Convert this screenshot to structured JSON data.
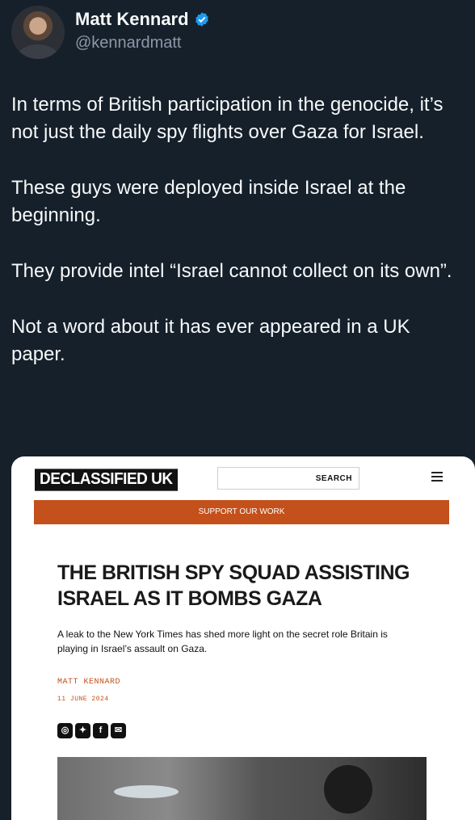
{
  "tweet": {
    "author_name": "Matt Kennard",
    "handle": "@kennardmatt",
    "verified": true,
    "paragraphs": [
      "In terms of British participation in the genocide, it’s not just the daily spy flights over Gaza for Israel.",
      "These guys were deployed inside Israel at the beginning.",
      "They provide intel “Israel cannot collect on its own”.",
      "Not a word about it has ever appeared in a UK paper."
    ]
  },
  "article": {
    "logo": "DECLASSIFIED UK",
    "search_label": "SEARCH",
    "support_label": "SUPPORT OUR WORK",
    "headline": "THE BRITISH SPY SQUAD ASSISTING ISRAEL AS IT BOMBS GAZA",
    "deck": "A leak to the New York Times has shed more light on the secret role Britain is playing in Israel’s assault on Gaza.",
    "byline": "MATT KENNARD",
    "date": "11 JUNE 2024",
    "share_icons": [
      "whatsapp-icon",
      "twitter-icon",
      "facebook-icon",
      "email-icon"
    ]
  },
  "colors": {
    "background": "#15202b",
    "verified": "#1d9bf0",
    "accent": "#c4501b"
  }
}
